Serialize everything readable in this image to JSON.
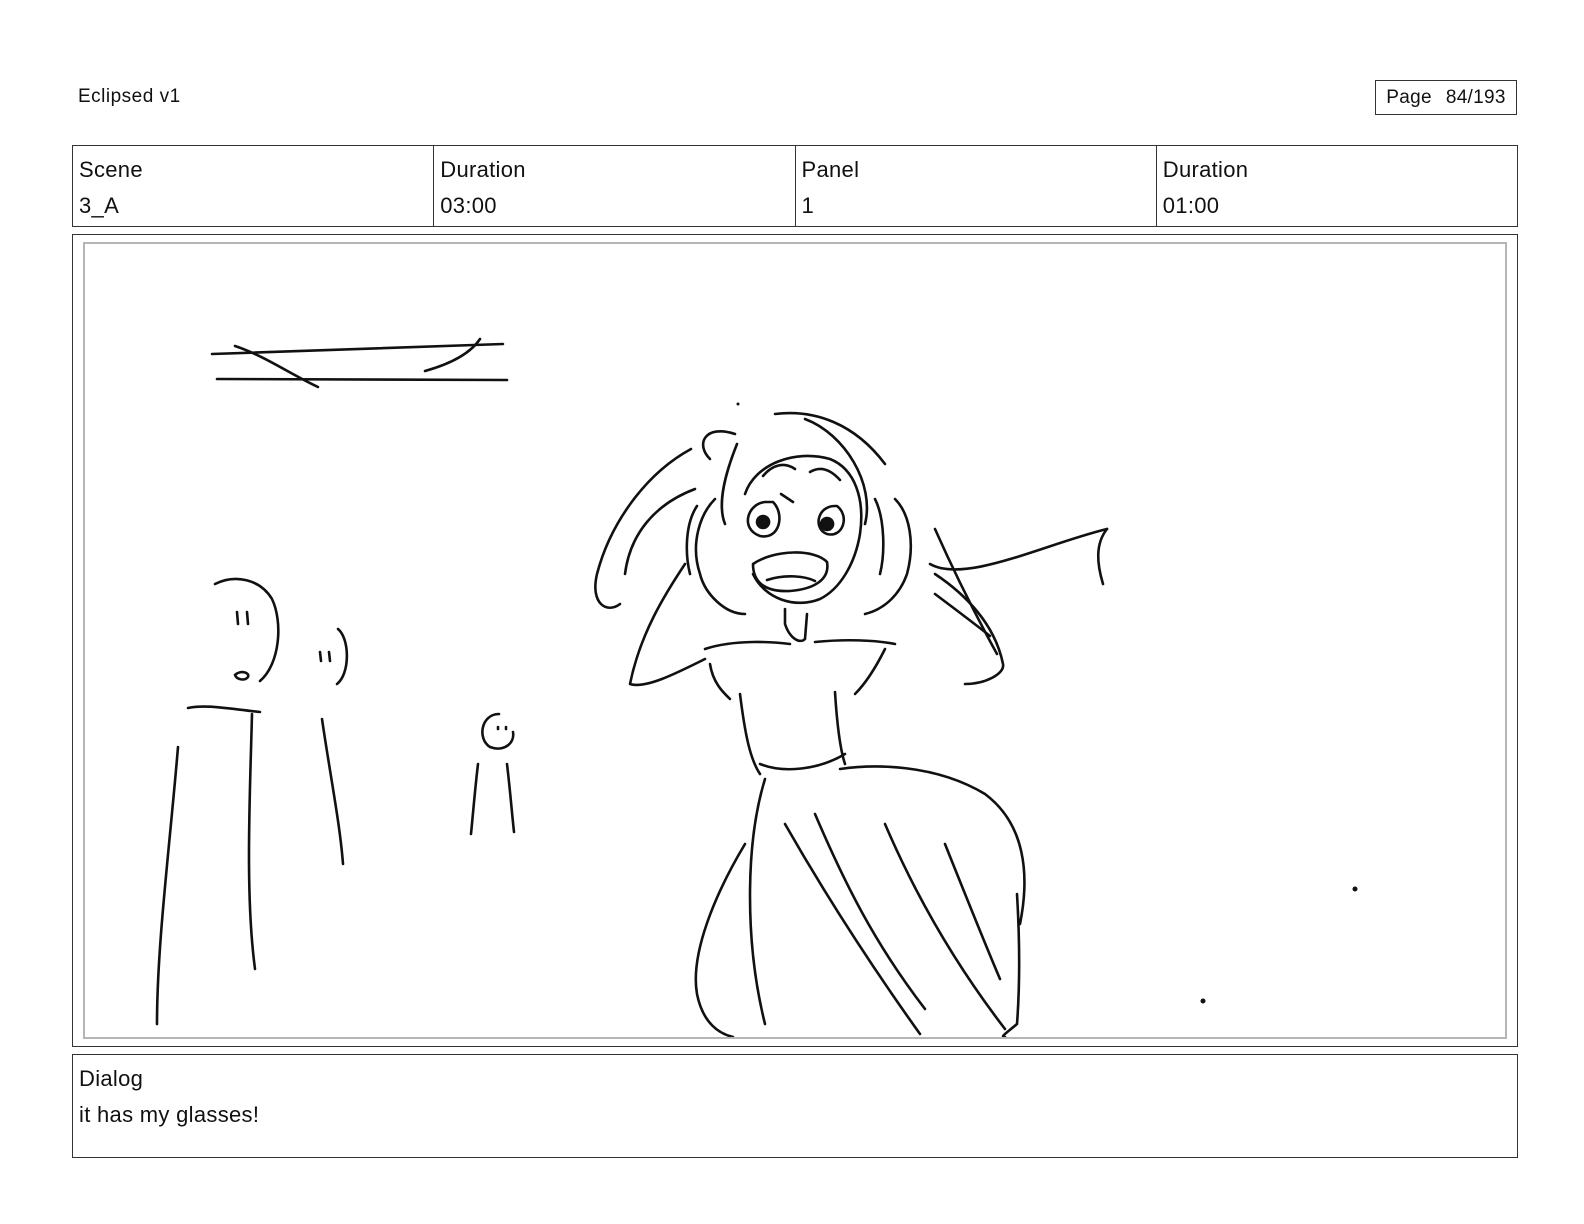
{
  "header": {
    "doc_title": "Eclipsed v1",
    "page_label": "Page",
    "page_number": "84/193"
  },
  "info": {
    "scene_label": "Scene",
    "scene_value": "3_A",
    "scene_duration_label": "Duration",
    "scene_duration_value": "03:00",
    "panel_label": "Panel",
    "panel_value": "1",
    "panel_duration_label": "Duration",
    "panel_duration_value": "01:00"
  },
  "dialog": {
    "label": "Dialog",
    "text": "it has my glasses!"
  }
}
